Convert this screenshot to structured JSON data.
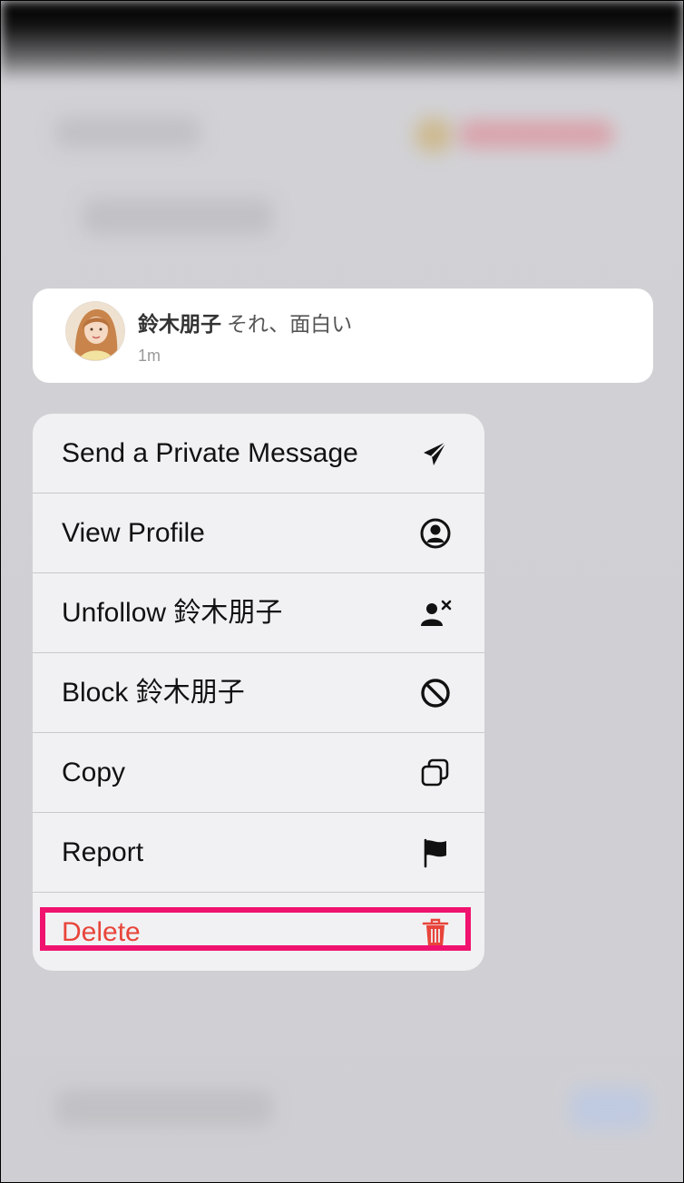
{
  "comment": {
    "author": "鈴木朋子",
    "text": "それ、面白い",
    "time": "1m"
  },
  "menu": {
    "items": [
      {
        "label": "Send a Private Message",
        "icon": "send-icon"
      },
      {
        "label": "View Profile",
        "icon": "profile-circle-icon"
      },
      {
        "label": "Unfollow 鈴木朋子",
        "icon": "unfollow-user-icon"
      },
      {
        "label": "Block 鈴木朋子",
        "icon": "block-icon"
      },
      {
        "label": "Copy",
        "icon": "copy-icon"
      },
      {
        "label": "Report",
        "icon": "flag-icon"
      },
      {
        "label": "Delete",
        "icon": "trash-icon"
      }
    ]
  },
  "colors": {
    "destructive": "#e8443a",
    "highlight_border": "#f0126f",
    "menu_background": "#f1f1f3",
    "overlay_background": "#d2d2d6"
  }
}
